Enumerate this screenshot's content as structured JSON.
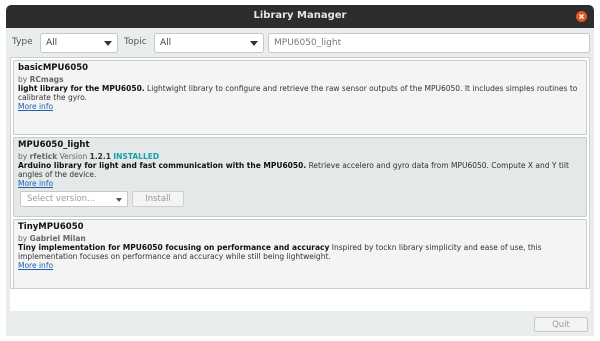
{
  "window": {
    "title": "Library Manager",
    "close_icon": "close-icon",
    "accent_color": "#e95420"
  },
  "filters": {
    "type_label": "Type",
    "type_value": "All",
    "topic_label": "Topic",
    "topic_value": "All",
    "search_value": "MPU6050_light"
  },
  "libraries": [
    {
      "name": "basicMPU6050",
      "by": "by",
      "author": "RCmags",
      "summary": "light library for the MPU6050.",
      "description": "Lightwight library to configure and retrieve the raw sensor outputs of the MPU6050. It includes simples routines to calibrate the gyro.",
      "more_info": "More info"
    },
    {
      "name": "MPU6050_light",
      "by": "by",
      "author": "rfetick",
      "version_label": "Version",
      "version": "1.2.1",
      "installed": "INSTALLED",
      "summary": "Arduino library for light and fast communication with the MPU6050.",
      "description": "Retrieve accelero and gyro data from MPU6050. Compute X and Y tilt angles of the device.",
      "more_info": "More info",
      "select_placeholder": "Select version...",
      "install_label": "Install"
    },
    {
      "name": "TinyMPU6050",
      "by": "by",
      "author": "Gabriel Milan",
      "summary": "Tiny implementation for MPU6050 focusing on performance and accuracy",
      "description": "Inspired by tockn library simplicity and ease of use, this implementation focuses on performance and accuracy while still being lightweight.",
      "more_info": "More info"
    }
  ],
  "footer": {
    "quit_label": "Quit"
  }
}
